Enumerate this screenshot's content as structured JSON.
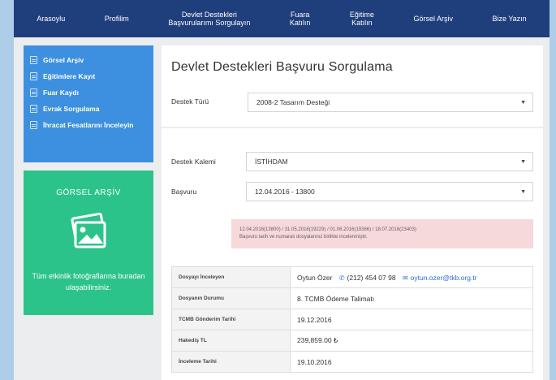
{
  "nav": {
    "items": [
      {
        "label": "Arasoylu"
      },
      {
        "label": "Profilim"
      },
      {
        "label": "Devlet Destekleri\nBaşvurularımı Sorgulayın"
      },
      {
        "label": "Fuara\nKatılın"
      },
      {
        "label": "Eğitime\nKatılın"
      },
      {
        "label": "Görsel Arşiv"
      },
      {
        "label": "Bize Yazın"
      }
    ]
  },
  "sidebar": {
    "items": [
      {
        "label": "Görsel Arşiv",
        "icon": "image-icon"
      },
      {
        "label": "Eğitimlere Kayıt",
        "icon": "document-icon"
      },
      {
        "label": "Fuar Kaydı",
        "icon": "document-icon"
      },
      {
        "label": "Evrak Sorgulama",
        "icon": "document-icon"
      },
      {
        "label": "İhracat Fesatlarını İnceleyin",
        "icon": "document-icon"
      }
    ]
  },
  "gallery": {
    "title": "GÖRSEL ARŞİV",
    "text": "Tüm etkinlik fotoğraflarına buradan ulaşabilirsiniz.",
    "icon": "photo-gallery-icon"
  },
  "main": {
    "title": "Devlet Destekleri Başvuru Sorgulama",
    "destek_turu_label": "Destek Türü",
    "destek_turu_value": "2008-2 Tasarım Desteği",
    "destek_kalemi_label": "Destek Kalemi",
    "destek_kalemi_value": "İSTİHDAM",
    "basvuru_label": "Başvuru",
    "basvuru_value": "12.04.2016 - 13800",
    "alert_line1": "12.04.2016(13800) / 31.05.2016(19229) / 01.06.2016(19366) / 18.07.2016(23403)",
    "alert_line2": "Başvuru tarih ve numaralı dosyalarınız birlikte incelenmiştir."
  },
  "details": {
    "rows": [
      {
        "key": "Dosyayı İnceleyen",
        "name": "Oytun Özer",
        "phone": "(212) 454 07 98",
        "email": "oytun.ozer@tkb.org.tr"
      },
      {
        "key": "Dosyanın Durumu",
        "value": "8. TCMB Ödeme Talimatı"
      },
      {
        "key": "TCMB Gönderim Tarihi",
        "value": "19.12.2016"
      },
      {
        "key": "Hakediş TL",
        "value": "239,859.00 ₺"
      },
      {
        "key": "İnceleme Tarihi",
        "value": "19.10.2016"
      }
    ]
  },
  "colors": {
    "nav_bg": "#1f3e7c",
    "sidebar_bg": "#3d8fe0",
    "gallery_bg": "#2cc38b",
    "alert_bg": "#f5d9db",
    "link": "#2b6fcf"
  }
}
